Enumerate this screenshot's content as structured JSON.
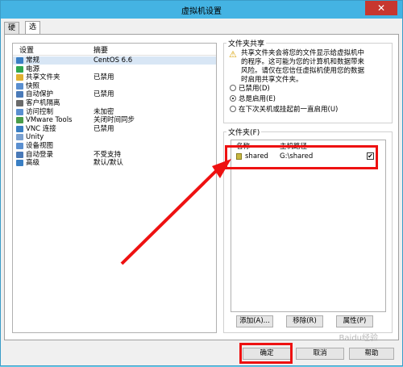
{
  "window": {
    "title": "虚拟机设置",
    "close_icon": "✕"
  },
  "tabs": [
    {
      "label": "硬件"
    },
    {
      "label": "选项"
    }
  ],
  "settings_list": {
    "headers": {
      "setting": "设置",
      "summary": "摘要"
    },
    "rows": [
      {
        "label": "常规",
        "value": "CentOS 6.6",
        "icon": "general-icon",
        "color": "#3a7fc4"
      },
      {
        "label": "电源",
        "value": "",
        "icon": "power-icon",
        "color": "#2fa84f"
      },
      {
        "label": "共享文件夹",
        "value": "已禁用",
        "icon": "shared-folder-icon",
        "color": "#e0b030"
      },
      {
        "label": "快照",
        "value": "",
        "icon": "snapshot-icon",
        "color": "#5a8fd0"
      },
      {
        "label": "自动保护",
        "value": "已禁用",
        "icon": "autoprotect-icon",
        "color": "#4a7ab8"
      },
      {
        "label": "客户机隔离",
        "value": "",
        "icon": "isolation-icon",
        "color": "#6a6a6a"
      },
      {
        "label": "访问控制",
        "value": "未加密",
        "icon": "access-control-icon",
        "color": "#5a8fd0"
      },
      {
        "label": "VMware Tools",
        "value": "关闭时间同步",
        "icon": "vmware-tools-icon",
        "color": "#4a9c4a"
      },
      {
        "label": "VNC 连接",
        "value": "已禁用",
        "icon": "vnc-icon",
        "color": "#3a7fc4"
      },
      {
        "label": "Unity",
        "value": "",
        "icon": "unity-icon",
        "color": "#7aa0d0"
      },
      {
        "label": "设备视图",
        "value": "",
        "icon": "device-view-icon",
        "color": "#5a8fd0"
      },
      {
        "label": "自动登录",
        "value": "不受支持",
        "icon": "autologin-icon",
        "color": "#4a7ab8"
      },
      {
        "label": "高级",
        "value": "默认/默认",
        "icon": "advanced-icon",
        "color": "#3a7fc4"
      }
    ]
  },
  "folder_sharing": {
    "group_label": "文件夹共享",
    "warning_icon": "⚠",
    "warning_text": [
      "共享文件夹会将您的文件显示给虚拟机中",
      "的程序。这可能为您的计算机和数据带来",
      "风险。请仅在您信任虚拟机使用您的数据",
      "时启用共享文件夹。"
    ],
    "options": [
      {
        "label": "已禁用(D)",
        "checked": false
      },
      {
        "label": "总是启用(E)",
        "checked": true
      },
      {
        "label": "在下次关机或挂起前一直启用(U)",
        "checked": false
      }
    ]
  },
  "folders": {
    "group_label": "文件夹(F)",
    "headers": {
      "name": "名称",
      "path": "主机路径"
    },
    "rows": [
      {
        "name": "shared",
        "path": "G:\\shared",
        "enabled": true
      }
    ],
    "add_label": "添加(A)...",
    "remove_label": "移除(R)",
    "properties_label": "属性(P)"
  },
  "footer": {
    "ok_label": "确定",
    "cancel_label": "取消",
    "help_label": "帮助"
  },
  "watermark": "Baidu经验",
  "colors": {
    "annotation": "#ee1111",
    "titlebar": "#44b3e3"
  }
}
